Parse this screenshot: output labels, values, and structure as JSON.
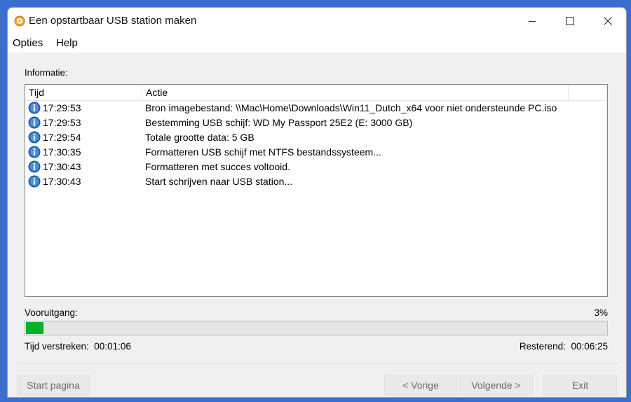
{
  "window": {
    "title": "Een opstartbaar USB station maken",
    "app_icon": "disc-icon"
  },
  "menu": {
    "items": [
      {
        "label": "Opties"
      },
      {
        "label": "Help"
      }
    ]
  },
  "info": {
    "label": "Informatie:",
    "columns": {
      "time": "Tijd",
      "action": "Actie"
    },
    "rows": [
      {
        "icon": "info-icon",
        "time": "17:29:53",
        "message": "Bron imagebestand: \\\\Mac\\Home\\Downloads\\Win11_Dutch_x64 voor niet ondersteunde PC.iso"
      },
      {
        "icon": "info-icon",
        "time": "17:29:53",
        "message": "Bestemming USB schijf: WD My Passport 25E2 (E:  3000 GB)"
      },
      {
        "icon": "info-icon",
        "time": "17:29:54",
        "message": "Totale grootte data: 5 GB"
      },
      {
        "icon": "info-icon",
        "time": "17:30:35",
        "message": "Formatteren USB schijf met NTFS bestandssysteem..."
      },
      {
        "icon": "info-icon",
        "time": "17:30:43",
        "message": "Formatteren met succes voltooid."
      },
      {
        "icon": "info-icon",
        "time": "17:30:43",
        "message": "Start schrijven naar USB station..."
      }
    ]
  },
  "progress": {
    "label": "Vooruitgang:",
    "percent_text": "3%",
    "value": 0.03,
    "color": "#06b025"
  },
  "timing": {
    "elapsed_label": "Tijd verstreken:",
    "elapsed_value": "00:01:06",
    "remaining_label": "Resterend:",
    "remaining_value": "00:06:25"
  },
  "buttons": {
    "start": "Start pagina",
    "prev": "< Vorige",
    "next": "Volgende >",
    "exit": "Exit"
  }
}
